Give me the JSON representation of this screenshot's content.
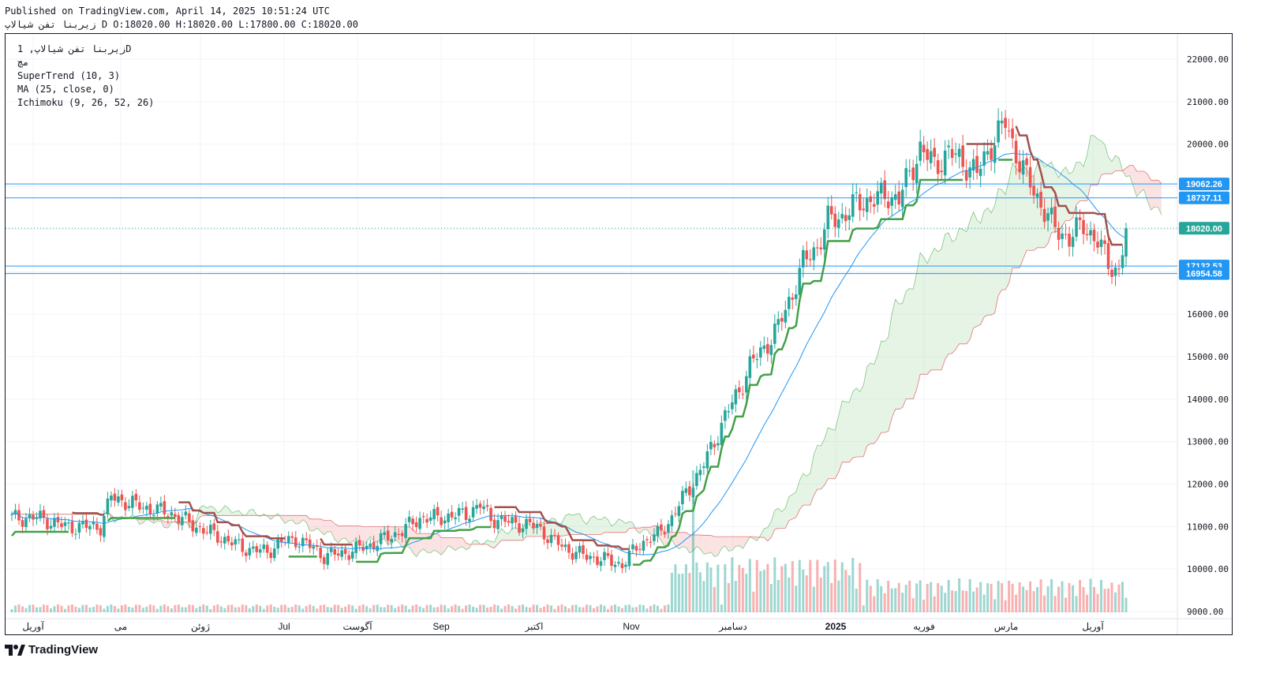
{
  "header": {
    "published": "Published on TradingView.com, April 14, 2025 10:51:24 UTC",
    "ohlc_line": "زیربنا تفن شیالاپ D O:18020.00 H:18020.00 L:17800.00 C:18020.00"
  },
  "legend": {
    "symbol": "زیربنا تفن شیالاپ, 1D",
    "sub": "مچ",
    "supertrend": "SuperTrend (10, 3)",
    "ma": "MA (25, close, 0)",
    "ichimoku": "Ichimoku (9, 26, 52, 26)"
  },
  "footer": {
    "brand": "TradingView"
  },
  "colors": {
    "up": "#26a69a",
    "down": "#ef5350",
    "supertrend_up": "#43a047",
    "supertrend_down": "#a1524d",
    "ma": "#2196f3",
    "cloud_green": "#a5d6a7",
    "cloud_red": "#ef9a9a",
    "hline": "#2196f3",
    "last_price": "#26a69a"
  },
  "chart_data": {
    "type": "candlestick",
    "interval": "1D",
    "y_axis": {
      "side": "right",
      "min": 9000,
      "max": 22000,
      "ticks": [
        "22000.00",
        "21000.00",
        "20000.00",
        "19000.00",
        "18000.00",
        "17000.00",
        "16000.00",
        "15000.00",
        "14000.00",
        "13000.00",
        "12000.00",
        "11000.00",
        "10000.00",
        "9000.00"
      ]
    },
    "x_axis": {
      "labels": [
        "آوریل",
        "می",
        "ژوئن",
        "Jul",
        "آگوست",
        "Sep",
        "اکتبر",
        "Nov",
        "دسامبر",
        "2025",
        "فوریه",
        "مارس",
        "آوریل"
      ],
      "bold_label": "2025"
    },
    "horizontal_lines": [
      {
        "value": 19062.26,
        "label": "19062.26"
      },
      {
        "value": 18737.11,
        "label": "18737.11"
      },
      {
        "value": 17132.53,
        "label": "17132.53"
      },
      {
        "value": 16954.58,
        "label": "16954.58"
      }
    ],
    "last_price": {
      "value": 18020.0,
      "label": "18020.00"
    },
    "indicators": [
      "SuperTrend (10, 3)",
      "MA (25, close, 0)",
      "Ichimoku (9, 26, 52, 26)"
    ],
    "price_path_approx": [
      [
        0,
        11200
      ],
      [
        8,
        11200
      ],
      [
        15,
        11000
      ],
      [
        25,
        11000
      ],
      [
        28,
        11700
      ],
      [
        35,
        11500
      ],
      [
        45,
        11300
      ],
      [
        52,
        11000
      ],
      [
        60,
        10700
      ],
      [
        65,
        10500
      ],
      [
        72,
        10400
      ],
      [
        75,
        10600
      ],
      [
        80,
        10700
      ],
      [
        85,
        10500
      ],
      [
        88,
        10300
      ],
      [
        95,
        10400
      ],
      [
        102,
        10600
      ],
      [
        110,
        10900
      ],
      [
        115,
        11200
      ],
      [
        120,
        11200
      ],
      [
        128,
        11300
      ],
      [
        132,
        11500
      ],
      [
        135,
        11200
      ],
      [
        140,
        11100
      ],
      [
        148,
        11000
      ],
      [
        152,
        10700
      ],
      [
        158,
        10400
      ],
      [
        162,
        10300
      ],
      [
        168,
        10200
      ],
      [
        172,
        10100
      ],
      [
        177,
        10600
      ],
      [
        182,
        10800
      ],
      [
        186,
        11200
      ],
      [
        190,
        11800
      ],
      [
        194,
        12300
      ],
      [
        198,
        13000
      ],
      [
        201,
        13600
      ],
      [
        205,
        14200
      ],
      [
        208,
        14800
      ],
      [
        212,
        15200
      ],
      [
        216,
        15700
      ],
      [
        220,
        16500
      ],
      [
        223,
        17200
      ],
      [
        227,
        17600
      ],
      [
        230,
        18200
      ],
      [
        234,
        18300
      ],
      [
        238,
        18600
      ],
      [
        243,
        18700
      ],
      [
        247,
        18800
      ],
      [
        250,
        18700
      ],
      [
        253,
        19300
      ],
      [
        256,
        19900
      ],
      [
        260,
        19500
      ],
      [
        264,
        19800
      ],
      [
        268,
        19600
      ],
      [
        272,
        19300
      ],
      [
        276,
        20000
      ],
      [
        280,
        20500
      ],
      [
        283,
        19800
      ],
      [
        286,
        19200
      ],
      [
        290,
        18600
      ],
      [
        294,
        18000
      ],
      [
        298,
        17800
      ],
      [
        302,
        18100
      ],
      [
        306,
        17700
      ],
      [
        309,
        17200
      ],
      [
        312,
        17000
      ],
      [
        314,
        18020
      ]
    ],
    "volume_scale_note": "volume histogram along bottom of pane"
  }
}
